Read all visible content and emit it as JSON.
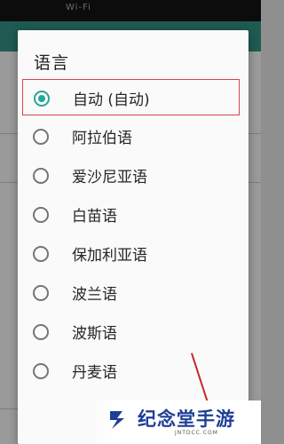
{
  "status_bar": {
    "text": "Wi-Fi"
  },
  "dialog": {
    "title": "语言",
    "options": [
      {
        "label": "自动 (自动)",
        "selected": true
      },
      {
        "label": "阿拉伯语",
        "selected": false
      },
      {
        "label": "爱沙尼亚语",
        "selected": false
      },
      {
        "label": "白苗语",
        "selected": false
      },
      {
        "label": "保加利亚语",
        "selected": false
      },
      {
        "label": "波兰语",
        "selected": false
      },
      {
        "label": "波斯语",
        "selected": false
      },
      {
        "label": "丹麦语",
        "selected": false
      }
    ]
  },
  "watermark": {
    "title": "纪念堂手游",
    "domain": "JNTDCC.COM"
  },
  "colors": {
    "app_bar": "#1f5b52",
    "radio_selected": "#26a69a",
    "highlight_box": "#d1454b",
    "watermark_text": "#1e3e97"
  }
}
